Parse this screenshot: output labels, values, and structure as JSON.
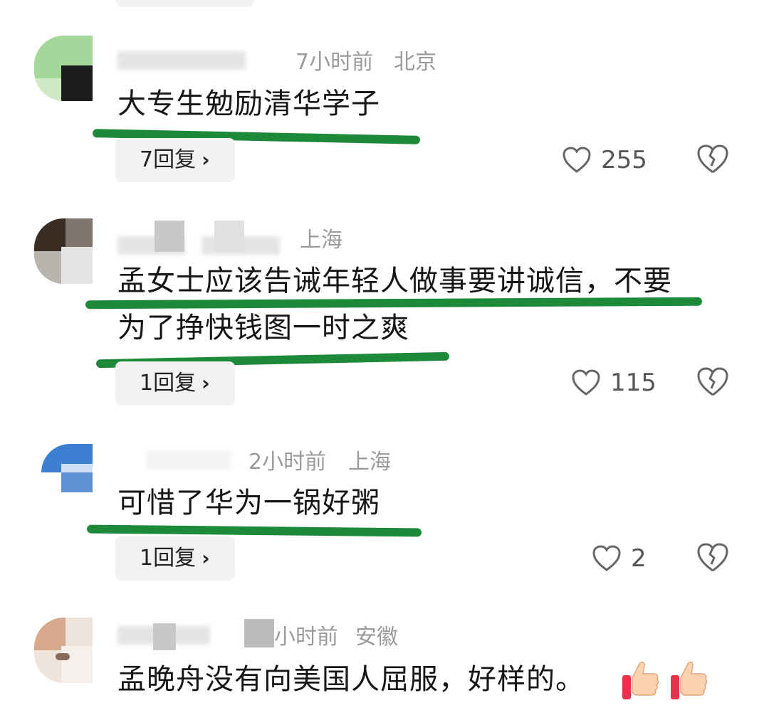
{
  "comments": [
    {
      "time": "7小时前",
      "location": "北京",
      "text_lines": [
        "大专生勉励清华学子"
      ],
      "reply_label": "7回复",
      "likes": "255"
    },
    {
      "time": "",
      "location": "上海",
      "text_lines": [
        "孟女士应该告诫年轻人做事要讲诚信，不要",
        "为了挣快钱图一时之爽"
      ],
      "reply_label": "1回复",
      "likes": "115"
    },
    {
      "time": "2小时前",
      "location": "上海",
      "text_lines": [
        "可惜了华为一锅好粥"
      ],
      "reply_label": "1回复",
      "likes": "2"
    },
    {
      "time": "小时前",
      "location": "安徽",
      "text_lines": [
        "孟晚舟没有向美国人屈服，好样的。"
      ],
      "emojis": [
        "thumbs-up",
        "thumbs-up"
      ]
    }
  ],
  "icons": {
    "like": "heart-outline-icon",
    "dislike": "broken-heart-icon",
    "chevron": "chevron-right-icon"
  },
  "colors": {
    "underline": "#1d8a3a",
    "meta_text": "#9a9a9a",
    "button_bg": "#f2f2f2"
  }
}
